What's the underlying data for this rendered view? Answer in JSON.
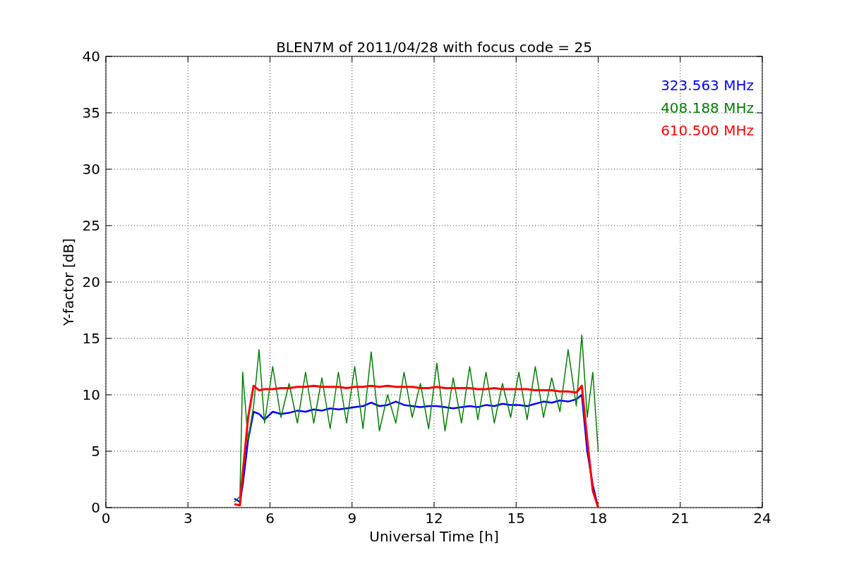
{
  "figure": {
    "chart_data": {
      "type": "line",
      "title": "BLEN7M of 2011/04/28 with focus code = 25",
      "xlabel": "Universal Time [h]",
      "ylabel": "Y-factor [dB]",
      "grid": true,
      "xlim": [
        0,
        24
      ],
      "ylim": [
        0,
        40
      ],
      "xticks": [
        0,
        3,
        6,
        9,
        12,
        15,
        18,
        21,
        24
      ],
      "yticks": [
        0,
        5,
        10,
        15,
        20,
        25,
        30,
        35,
        40
      ],
      "x": [
        4.7,
        4.9,
        5.0,
        5.2,
        5.4,
        5.6,
        5.8,
        6.1,
        6.4,
        6.7,
        7.0,
        7.3,
        7.6,
        7.9,
        8.2,
        8.5,
        8.8,
        9.1,
        9.4,
        9.7,
        10.0,
        10.3,
        10.6,
        10.9,
        11.2,
        11.5,
        11.8,
        12.1,
        12.4,
        12.7,
        13.0,
        13.3,
        13.6,
        13.9,
        14.2,
        14.5,
        14.8,
        15.1,
        15.4,
        15.7,
        16.0,
        16.3,
        16.6,
        16.9,
        17.2,
        17.4,
        17.6,
        17.8,
        18.0
      ],
      "series": [
        {
          "name": "323.563 MHz",
          "color": "#0000ff",
          "values": [
            0.8,
            0.5,
            2,
            6,
            8.5,
            8.3,
            7.8,
            8.5,
            8.3,
            8.4,
            8.6,
            8.5,
            8.7,
            8.6,
            8.8,
            8.7,
            8.8,
            8.9,
            9.0,
            9.3,
            9.0,
            9.1,
            9.4,
            9.1,
            9.0,
            8.9,
            9.0,
            9.0,
            8.9,
            8.8,
            8.9,
            9.0,
            8.9,
            9.1,
            9.0,
            9.2,
            9.1,
            9.1,
            9.0,
            9.2,
            9.4,
            9.3,
            9.5,
            9.4,
            9.6,
            10,
            5,
            2,
            0
          ]
        },
        {
          "name": "408.188 MHz",
          "color": "#008000",
          "values": [
            0.5,
            1,
            12,
            6,
            9,
            14,
            7.5,
            12.5,
            8,
            11,
            7.5,
            12,
            7.5,
            11.5,
            7,
            12,
            7.5,
            12.5,
            7,
            13.8,
            6.8,
            10,
            7.5,
            12,
            8,
            11,
            7,
            12.8,
            6.8,
            11.5,
            7.5,
            12.5,
            7.8,
            12,
            7.5,
            11,
            8,
            12,
            7.8,
            12.5,
            8,
            11.5,
            8.5,
            14,
            9,
            15.3,
            8,
            12,
            5
          ]
        },
        {
          "name": "610.500 MHz",
          "color": "#ff0000",
          "values": [
            0.3,
            0.2,
            3,
            8,
            10.8,
            10.4,
            10.5,
            10.5,
            10.6,
            10.6,
            10.7,
            10.7,
            10.8,
            10.7,
            10.7,
            10.7,
            10.6,
            10.7,
            10.7,
            10.8,
            10.7,
            10.8,
            10.7,
            10.7,
            10.7,
            10.6,
            10.6,
            10.7,
            10.6,
            10.6,
            10.6,
            10.6,
            10.5,
            10.5,
            10.6,
            10.5,
            10.5,
            10.5,
            10.5,
            10.4,
            10.4,
            10.4,
            10.3,
            10.3,
            10.2,
            10.8,
            6,
            1.5,
            0
          ]
        }
      ]
    }
  }
}
